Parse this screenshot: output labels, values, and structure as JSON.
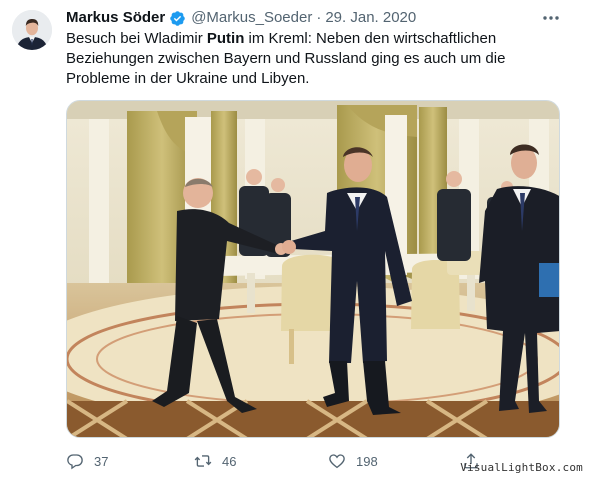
{
  "tweet": {
    "author_name": "Markus Söder",
    "handle": "@Markus_Soeder",
    "separator": "·",
    "date": "29. Jan. 2020",
    "text_part1": "Besuch bei Wladimir ",
    "text_bold": "Putin",
    "text_part2": " im Kreml: Neben den wirtschaftlichen Beziehungen zwischen Bayern und Russland ging es auch um die Probleme in der Ukraine und Libyen.",
    "verified_color": "#1d9bf0"
  },
  "icons": {
    "avatar": "avatar-photo",
    "verified": "verified-badge-icon",
    "more": "more-options-icon",
    "reply": "reply-icon",
    "retweet": "retweet-icon",
    "like": "like-icon",
    "share": "share-icon"
  },
  "actions": {
    "reply_count": "37",
    "retweet_count": "46",
    "like_count": "198"
  },
  "watermark": "VisualLightBox.com"
}
